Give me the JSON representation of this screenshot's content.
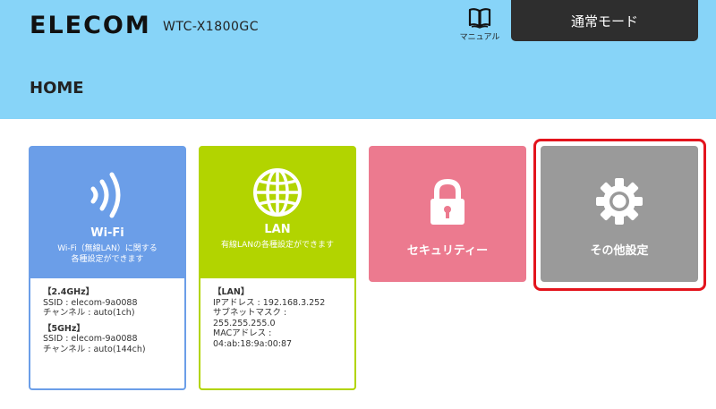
{
  "header": {
    "logo": "ELECOM",
    "model": "WTC-X1800GC",
    "manual_label": "マニュアル",
    "mode_button": "通常モード",
    "page_title": "HOME"
  },
  "tiles": {
    "wifi": {
      "title": "Wi-Fi",
      "desc_line1": "Wi-Fi（無線LAN）に関する",
      "desc_line2": "各種設定ができます",
      "info": {
        "sec24": "【2.4GHz】",
        "ssid24": "SSID : elecom-9a0088",
        "ch24": "チャンネル : auto(1ch)",
        "sec5": "【5GHz】",
        "ssid5": "SSID : elecom-9a0088",
        "ch5": "チャンネル : auto(144ch)"
      }
    },
    "lan": {
      "title": "LAN",
      "desc": "有線LANの各種設定ができます",
      "info": {
        "sec": "【LAN】",
        "ip": "IPアドレス : 192.168.3.252",
        "mask_label": "サブネットマスク :",
        "mask": "255.255.255.0",
        "mac_label": "MACアドレス :",
        "mac": "04:ab:18:9a:00:87"
      }
    },
    "security": {
      "title": "セキュリティー"
    },
    "other": {
      "title": "その他設定"
    }
  },
  "colors": {
    "header_bg": "#87d4f8",
    "wifi": "#6b9ee8",
    "lan": "#b2d400",
    "security": "#ec7a8f",
    "other": "#9a9a9a",
    "highlight": "#e3141d"
  }
}
